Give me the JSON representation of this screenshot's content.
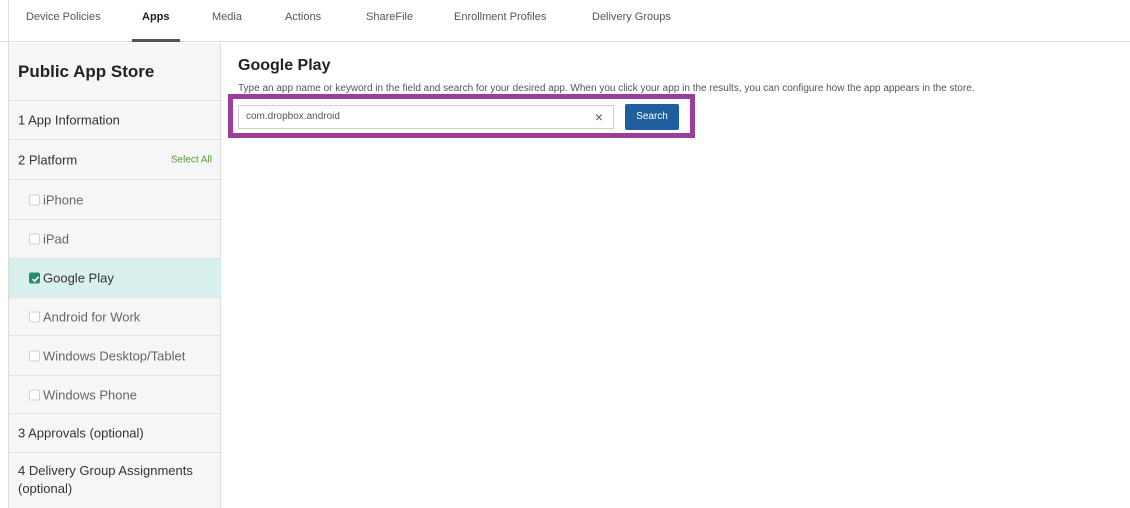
{
  "top_tabs": [
    {
      "label": "Device Policies"
    },
    {
      "label": "Apps"
    },
    {
      "label": "Media"
    },
    {
      "label": "Actions"
    },
    {
      "label": "ShareFile"
    },
    {
      "label": "Enrollment Profiles"
    },
    {
      "label": "Delivery Groups"
    }
  ],
  "active_tab": "Apps",
  "sidebar": {
    "title": "Public App Store",
    "step1": "1  App Information",
    "step2": "2  Platform",
    "select_all": "Select All",
    "platforms": [
      {
        "label": "iPhone",
        "checked": false
      },
      {
        "label": "iPad",
        "checked": false
      },
      {
        "label": "Google Play",
        "checked": true
      },
      {
        "label": "Android for Work",
        "checked": false
      },
      {
        "label": "Windows Desktop/Tablet",
        "checked": false
      },
      {
        "label": "Windows Phone",
        "checked": false
      }
    ],
    "step3": "3  Approvals (optional)",
    "step4": "4  Delivery Group Assignments (optional)"
  },
  "main": {
    "title": "Google Play",
    "description": "Type an app name or keyword in the field and search for your desired app. When you click your app in the results, you can configure how the app appears in the store.",
    "search_value": "com.dropbox.android",
    "clear_glyph": "×",
    "search_button": "Search"
  },
  "colors": {
    "highlight": "#9b3d9b",
    "search_button": "#1f5fa0",
    "selected_row": "#d8f0ee",
    "select_all": "#5b9a3a"
  }
}
